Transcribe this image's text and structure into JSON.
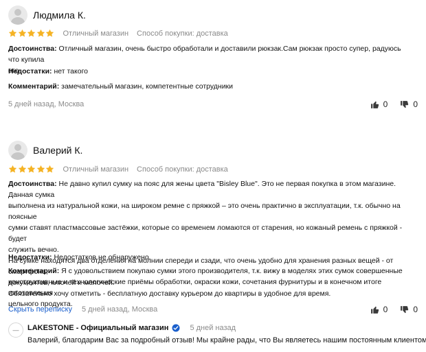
{
  "colors": {
    "star": "#f5b324",
    "link": "#1a5fcc",
    "verified": "#1a5fcc",
    "muted": "#8a8a8a"
  },
  "reviews": [
    {
      "name": "Людмила К.",
      "rating": 5,
      "shop_rating": "Отличный магазин",
      "purchase_method": "Способ покупки: доставка",
      "pros_label": "Достоинства:",
      "pros_lines": [
        "Отличный магазин, очень быстро обработали и доставили рюкзак.Сам рюкзак просто супер, радуюсь что купила",
        "его"
      ],
      "cons_label": "Недостатки:",
      "cons": "нет такого",
      "comment_label": "Комментарий:",
      "comment_lines": [
        "замечательный магазин, компетентные сотрудники"
      ],
      "date": "5 дней назад, Москва",
      "likes": "0",
      "dislikes": "0"
    },
    {
      "name": "Валерий К.",
      "rating": 5,
      "shop_rating": "Отличный магазин",
      "purchase_method": "Способ покупки: доставка",
      "pros_label": "Достоинства:",
      "pros_lines": [
        "Не давно купил сумку на пояс для жены цвета \"Bisley Blue\". Это не первая покупка в этом магазине. Данная сумка",
        "выполнена из натуральной кожи, на широком ремне с пряжкой – это очень практично в эксплуатации, т.к. обычно на поясные",
        "сумки ставят пластмассовые застёжки, которые со временем ломаются от старения, но кожаный ремень с пряжкой - будет",
        "служить вечно.",
        "На сумке находятся два отделения на молнии спереди и сзади, что очень удобно для хранения разных вещей - от смартфона,",
        "документов, ключей и мелочей.",
        "Обязательно хочу отметить - бесплатную доставку курьером до квартиры в удобное для время."
      ],
      "cons_label": "Недостатки:",
      "cons": "Недостатков не обнаружено.",
      "comment_label": "Комментарий:",
      "comment_lines": [
        "Я с удовольствием покупаю сумки этого производителя, т.к. вижу в моделях этих сумок совершенные",
        "конструктивные и технологические приёмы обработки, окраски кожи, сочетания фурнитуры и в конечном итоге изготовления",
        "цельного продукта."
      ],
      "hide_thread": "Скрыть переписку",
      "date": "5 дней назад, Москва",
      "likes": "0",
      "dislikes": "0",
      "reply": {
        "shop_name": "LAKESTONE - Официальный магазин",
        "date": "5 дней назад",
        "text": "Валерий, благодарим Вас за подробный отзыв! Мы крайне рады, что Вы являетесь нашим постоянным клиентом!"
      }
    }
  ]
}
